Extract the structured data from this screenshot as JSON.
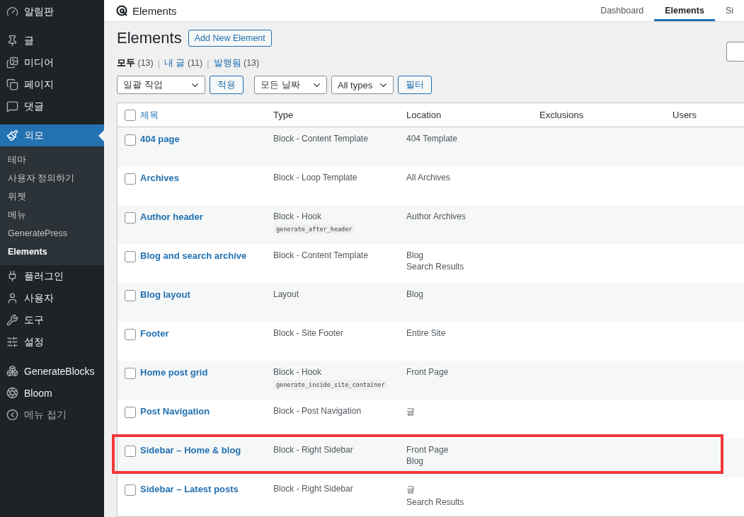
{
  "sidebar": {
    "items": [
      {
        "label": "알림판",
        "selected": false
      },
      {
        "label": "글",
        "selected": false
      },
      {
        "label": "미디어",
        "selected": false
      },
      {
        "label": "페이지",
        "selected": false
      },
      {
        "label": "댓글",
        "selected": false
      },
      {
        "label": "외모",
        "selected": true,
        "children": [
          {
            "label": "테마",
            "selected": false
          },
          {
            "label": "사용자 정의하기",
            "selected": false
          },
          {
            "label": "위젯",
            "selected": false
          },
          {
            "label": "메뉴",
            "selected": false
          },
          {
            "label": "GeneratePress",
            "selected": false
          },
          {
            "label": "Elements",
            "selected": true
          }
        ]
      },
      {
        "label": "플러그인",
        "selected": false
      },
      {
        "label": "사용자",
        "selected": false
      },
      {
        "label": "도구",
        "selected": false
      },
      {
        "label": "설정",
        "selected": false
      },
      {
        "label": "GenerateBlocks",
        "selected": false
      },
      {
        "label": "Bloom",
        "selected": false
      },
      {
        "label": "메뉴 접기",
        "selected": false,
        "kind": "collapse"
      }
    ]
  },
  "header": {
    "title": "Elements",
    "tabs": [
      {
        "label": "Dashboard",
        "selected": false
      },
      {
        "label": "Elements",
        "selected": true
      },
      {
        "label": "Si",
        "selected": false
      }
    ]
  },
  "page": {
    "title": "Elements",
    "add_button": "Add New Element"
  },
  "views": [
    {
      "label": "모두",
      "count": "(13)",
      "selected": true
    },
    {
      "separator": "|",
      "label": "내 글",
      "count": "(11)",
      "selected": false
    },
    {
      "separator": "|",
      "label": "발행됨",
      "count": "(13)",
      "selected": false
    }
  ],
  "filters": {
    "bulk_action": "일괄 작업",
    "apply": "적용",
    "date": "모든 날짜",
    "types": "All types",
    "filter": "필터"
  },
  "table": {
    "select_all_checked": false,
    "columns": [
      "제목",
      "Type",
      "Location",
      "Exclusions",
      "Users"
    ],
    "rows": [
      {
        "title": "404 page",
        "type": "Block - Content Template",
        "locations": [
          "404 Template"
        ],
        "checked": false,
        "highlighted": false
      },
      {
        "title": "Archives",
        "type": "Block - Loop Template",
        "locations": [
          "All Archives"
        ],
        "checked": false,
        "highlighted": false
      },
      {
        "title": "Author header",
        "type": "Block - Hook",
        "hook": "generate_after_header",
        "locations": [
          "Author Archives"
        ],
        "checked": false,
        "highlighted": false
      },
      {
        "title": "Blog and search archive",
        "type": "Block - Content Template",
        "locations": [
          "Blog",
          "Search Results"
        ],
        "checked": false,
        "highlighted": false
      },
      {
        "title": "Blog layout",
        "type": "Layout",
        "locations": [
          "Blog"
        ],
        "checked": false,
        "highlighted": false
      },
      {
        "title": "Footer",
        "type": "Block - Site Footer",
        "locations": [
          "Entire Site"
        ],
        "checked": false,
        "highlighted": false
      },
      {
        "title": "Home post grid",
        "type": "Block - Hook",
        "hook": "generate_inside_site_container",
        "locations": [
          "Front Page"
        ],
        "checked": false,
        "highlighted": false
      },
      {
        "title": "Post Navigation",
        "type": "Block - Post Navigation",
        "locations": [
          "글"
        ],
        "checked": false,
        "highlighted": false
      },
      {
        "title": "Sidebar – Home & blog",
        "type": "Block - Right Sidebar",
        "locations": [
          "Front Page",
          "Blog"
        ],
        "checked": false,
        "highlighted": true
      },
      {
        "title": "Sidebar – Latest posts",
        "type": "Block - Right Sidebar",
        "locations": [
          "글",
          "Search Results"
        ],
        "checked": false,
        "highlighted": false
      }
    ]
  }
}
